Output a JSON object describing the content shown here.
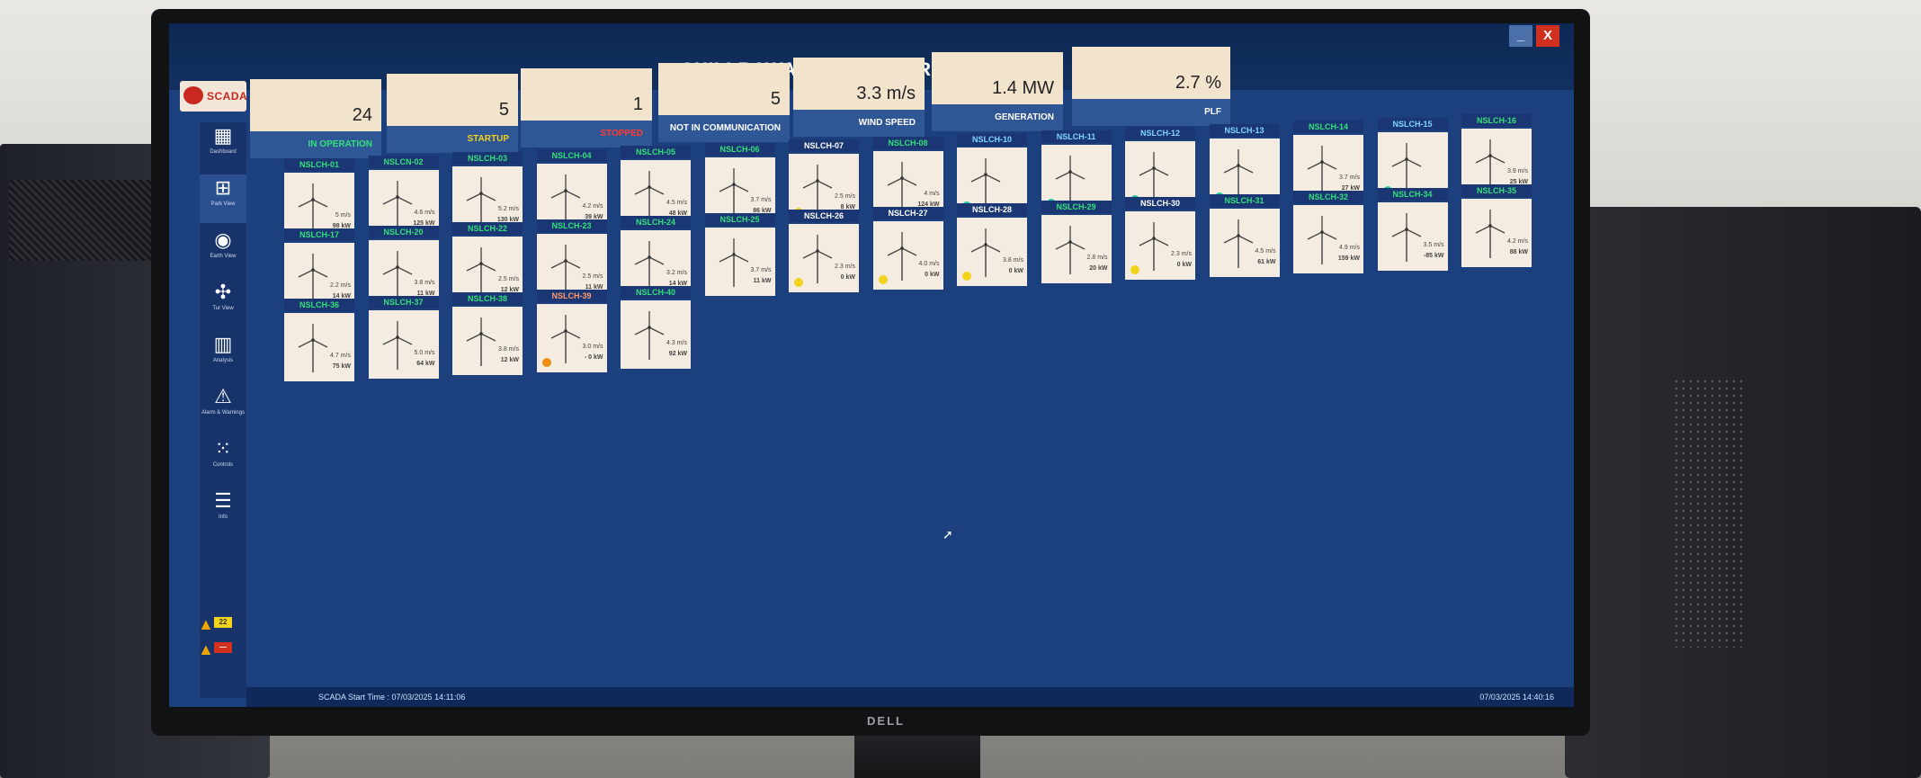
{
  "window": {
    "title": "CHILLRAWADI - WIND FARM PARK VIEW",
    "minimize_label": "_",
    "close_label": "X"
  },
  "logo": {
    "text": "SCADA"
  },
  "sidebar": {
    "items": [
      {
        "label": "Dashboard",
        "icon": "dashboard-icon",
        "glyph": "▦"
      },
      {
        "label": "Park View",
        "icon": "grid-icon",
        "glyph": "⊞"
      },
      {
        "label": "Earth View",
        "icon": "globe-icon",
        "glyph": "◉"
      },
      {
        "label": "Tur View",
        "icon": "fan-icon",
        "glyph": "✣"
      },
      {
        "label": "Analysis",
        "icon": "bar-chart-icon",
        "glyph": "▥"
      },
      {
        "label": "Alarm & Warnings",
        "icon": "alarm-icon",
        "glyph": "⚠"
      },
      {
        "label": "Controls",
        "icon": "keypad-icon",
        "glyph": "⁙"
      },
      {
        "label": "Info",
        "icon": "menu-icon",
        "glyph": "☰"
      }
    ],
    "alarm_counts": [
      "22",
      "—"
    ]
  },
  "colors": {
    "status_green_text": "#35e07a",
    "status_red_text": "#ff3b2f",
    "dot_teal": "#1ecb9b",
    "dot_yellow": "#f2d21b",
    "dot_orange": "#ef8d12"
  },
  "summary": [
    {
      "value": "24",
      "label": "IN OPERATION",
      "label_color": "#35e07a"
    },
    {
      "value": "5",
      "label": "STARTUP",
      "label_color": "#f2d21b"
    },
    {
      "value": "1",
      "label": "STOPPED",
      "label_color": "#ff3b2f"
    },
    {
      "value": "5",
      "label": "NOT IN COMMUNICATION",
      "label_color": "#ffffff"
    },
    {
      "value": "3.3 m/s",
      "label": "WIND SPEED",
      "label_color": "#ffffff"
    },
    {
      "value": "1.4 MW",
      "label": "GENERATION",
      "label_color": "#ffffff"
    },
    {
      "value": "2.7 %",
      "label": "PLF",
      "label_color": "#ffffff"
    }
  ],
  "turbines_row1": [
    {
      "name": "NSLCH-01",
      "wind": "5 m/s",
      "power": "98 kW",
      "status": "ok"
    },
    {
      "name": "NSLCN-02",
      "wind": "4.6 m/s",
      "power": "125 kW",
      "status": "ok"
    },
    {
      "name": "NSLCH-03",
      "wind": "5.2 m/s",
      "power": "130 kW",
      "status": "ok"
    },
    {
      "name": "NSLCH-04",
      "wind": "4.2 m/s",
      "power": "39 kW",
      "status": "ok"
    },
    {
      "name": "NSLCH-05",
      "wind": "4.5 m/s",
      "power": "48 kW",
      "status": "ok"
    },
    {
      "name": "NSLCH-06",
      "wind": "3.7 m/s",
      "power": "86 kW",
      "status": "ok"
    },
    {
      "name": "NSLCH-07",
      "wind": "2.5 m/s",
      "power": "8 kW",
      "status": "startup"
    },
    {
      "name": "NSLCH-08",
      "wind": "4 m/s",
      "power": "124 kW",
      "status": "ok"
    },
    {
      "name": "NSLCH-10",
      "wind": "",
      "power": "",
      "status": "nocomm"
    },
    {
      "name": "NSLCH-11",
      "wind": "",
      "power": "",
      "status": "nocomm"
    },
    {
      "name": "NSLCH-12",
      "wind": "",
      "power": "",
      "status": "nocomm"
    },
    {
      "name": "NSLCH-13",
      "wind": "",
      "power": "",
      "status": "nocomm"
    },
    {
      "name": "NSLCH-14",
      "wind": "3.7 m/s",
      "power": "27 kW",
      "status": "ok"
    },
    {
      "name": "NSLCH-15",
      "wind": "",
      "power": "",
      "status": "nocomm"
    },
    {
      "name": "NSLCH-16",
      "wind": "3.9 m/s",
      "power": "25 kW",
      "status": "ok"
    }
  ],
  "turbines_row2": [
    {
      "name": "NSLCH-17",
      "wind": "2.2 m/s",
      "power": "14 kW",
      "status": "ok"
    },
    {
      "name": "NSLCH-20",
      "wind": "3.8 m/s",
      "power": "11 kW",
      "status": "ok"
    },
    {
      "name": "NSLCH-22",
      "wind": "2.5 m/s",
      "power": "12 kW",
      "status": "ok"
    },
    {
      "name": "NSLCH-23",
      "wind": "2.5 m/s",
      "power": "11 kW",
      "status": "ok"
    },
    {
      "name": "NSLCH-24",
      "wind": "3.2 m/s",
      "power": "14 kW",
      "status": "ok"
    },
    {
      "name": "NSLCH-25",
      "wind": "3.7 m/s",
      "power": "11 kW",
      "status": "ok"
    },
    {
      "name": "NSLCH-26",
      "wind": "2.3 m/s",
      "power": "0 kW",
      "status": "startup"
    },
    {
      "name": "NSLCH-27",
      "wind": "4.0 m/s",
      "power": "0 kW",
      "status": "startup"
    },
    {
      "name": "NSLCH-28",
      "wind": "3.8 m/s",
      "power": "0 kW",
      "status": "startup"
    },
    {
      "name": "NSLCH-29",
      "wind": "2.8 m/s",
      "power": "20 kW",
      "status": "ok"
    },
    {
      "name": "NSLCH-30",
      "wind": "2.3 m/s",
      "power": "0 kW",
      "status": "startup"
    },
    {
      "name": "NSLCH-31",
      "wind": "4.5 m/s",
      "power": "61 kW",
      "status": "ok"
    },
    {
      "name": "NSLCH-32",
      "wind": "4.9 m/s",
      "power": "159 kW",
      "status": "ok"
    },
    {
      "name": "NSLCH-34",
      "wind": "3.5 m/s",
      "power": "-85 kW",
      "status": "ok"
    },
    {
      "name": "NSLCH-35",
      "wind": "4.2 m/s",
      "power": "88 kW",
      "status": "ok"
    }
  ],
  "turbines_row3": [
    {
      "name": "NSLCH-36",
      "wind": "4.7 m/s",
      "power": "75 kW",
      "status": "ok"
    },
    {
      "name": "NSLCH-37",
      "wind": "5.0 m/s",
      "power": "64 kW",
      "status": "ok"
    },
    {
      "name": "NSLCH-38",
      "wind": "3.8 m/s",
      "power": "12 kW",
      "status": "ok"
    },
    {
      "name": "NSLCH-39",
      "wind": "3.0 m/s",
      "power": "- 0 kW",
      "status": "stopped"
    },
    {
      "name": "NSLCH-40",
      "wind": "4.3 m/s",
      "power": "92 kW",
      "status": "ok"
    }
  ],
  "statusbar": {
    "left": "SCADA Start Time :   07/03/2025 14:11:06",
    "right": "07/03/2025 14:40:16"
  },
  "monitor_brand": "DELL"
}
